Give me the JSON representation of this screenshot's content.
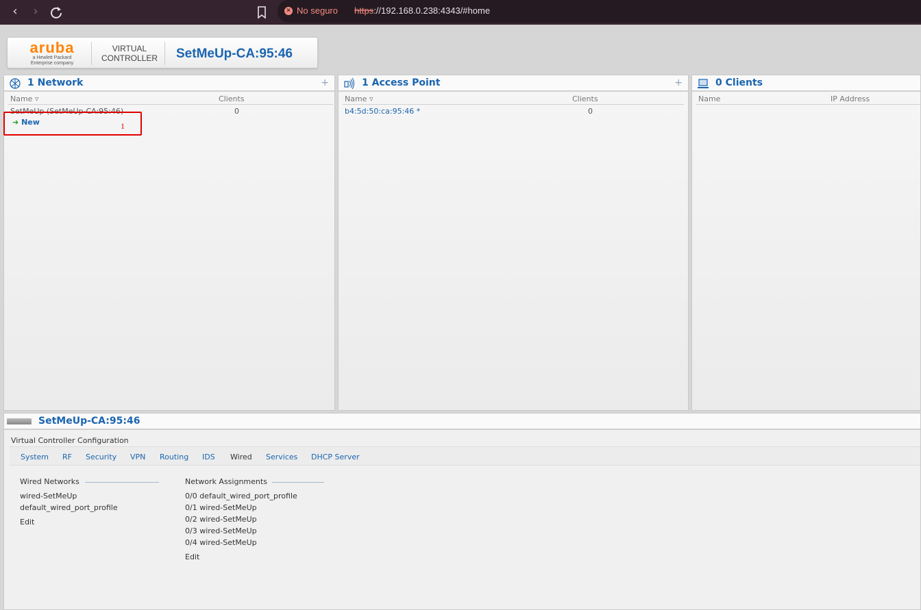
{
  "browser": {
    "security_label": "No seguro",
    "url_scheme": "https",
    "url_rest": "://192.168.0.238:4343/#home"
  },
  "header": {
    "logo_word": "aruba",
    "logo_sub1": "a Hewlett Packard",
    "logo_sub2": "Enterprise company",
    "vc_line1": "VIRTUAL",
    "vc_line2": "CONTROLLER",
    "vc_name": "SetMeUp-CA:95:46"
  },
  "networks": {
    "title": "1 Network",
    "col_name": "Name",
    "col_clients": "Clients",
    "rows": [
      {
        "name": "SetMeUp (SetMeUp-CA:95:46)",
        "clients": "0"
      }
    ],
    "new_label": "New",
    "annotation": "1"
  },
  "access_points": {
    "title": "1 Access Point",
    "col_name": "Name",
    "col_clients": "Clients",
    "rows": [
      {
        "name": "b4:5d:50:ca:95:46 *",
        "clients": "0"
      }
    ]
  },
  "clients": {
    "title": "0 Clients",
    "col_name": "Name",
    "col_ip": "IP Address"
  },
  "bottom": {
    "title": "SetMeUp-CA:95:46",
    "config_title": "Virtual Controller Configuration",
    "tabs": [
      "System",
      "RF",
      "Security",
      "VPN",
      "Routing",
      "IDS",
      "Wired",
      "Services",
      "DHCP Server"
    ],
    "active_tab": "Wired",
    "wired_networks": {
      "heading": "Wired Networks",
      "items": [
        "wired-SetMeUp",
        "default_wired_port_profile"
      ],
      "edit": "Edit"
    },
    "network_assignments": {
      "heading": "Network Assignments",
      "items": [
        "0/0 default_wired_port_profile",
        "0/1 wired-SetMeUp",
        "0/2 wired-SetMeUp",
        "0/3 wired-SetMeUp",
        "0/4 wired-SetMeUp"
      ],
      "edit": "Edit"
    }
  },
  "colors": {
    "accent": "#1a65b0",
    "brand": "#ff8300",
    "highlight": "#e00000"
  }
}
